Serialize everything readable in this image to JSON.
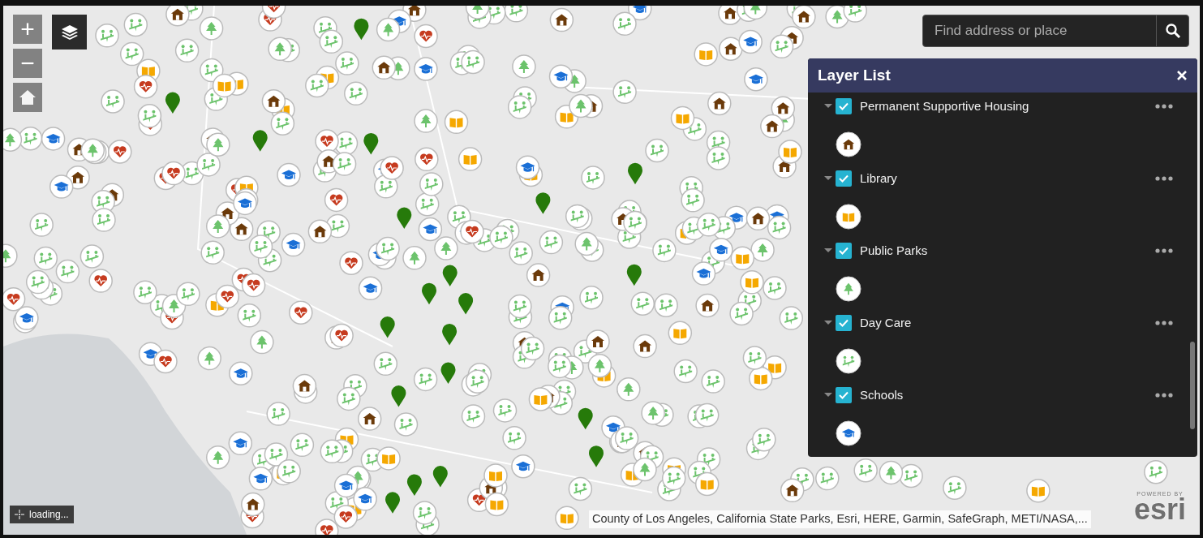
{
  "map_controls": {
    "zoom_in": "+",
    "zoom_out": "−"
  },
  "search": {
    "placeholder": "Find address or place"
  },
  "layer_list": {
    "title": "Layer List",
    "layers": [
      {
        "title": "Permanent Supportive Housing",
        "checked": true,
        "expanded": true,
        "kind": "house"
      },
      {
        "title": "Library",
        "checked": true,
        "expanded": true,
        "kind": "book"
      },
      {
        "title": "Public Parks",
        "checked": true,
        "expanded": true,
        "kind": "tree"
      },
      {
        "title": "Day Care",
        "checked": true,
        "expanded": true,
        "kind": "daycare"
      },
      {
        "title": "Schools",
        "checked": true,
        "expanded": true,
        "kind": "school"
      }
    ]
  },
  "status": {
    "text": "loading..."
  },
  "attribution": "County of Los Angeles, California State Parks, Esri, HERE, Garmin, SafeGraph, METI/NASA,...",
  "logo": {
    "caption": "POWERED BY",
    "wordmark": "esri"
  }
}
